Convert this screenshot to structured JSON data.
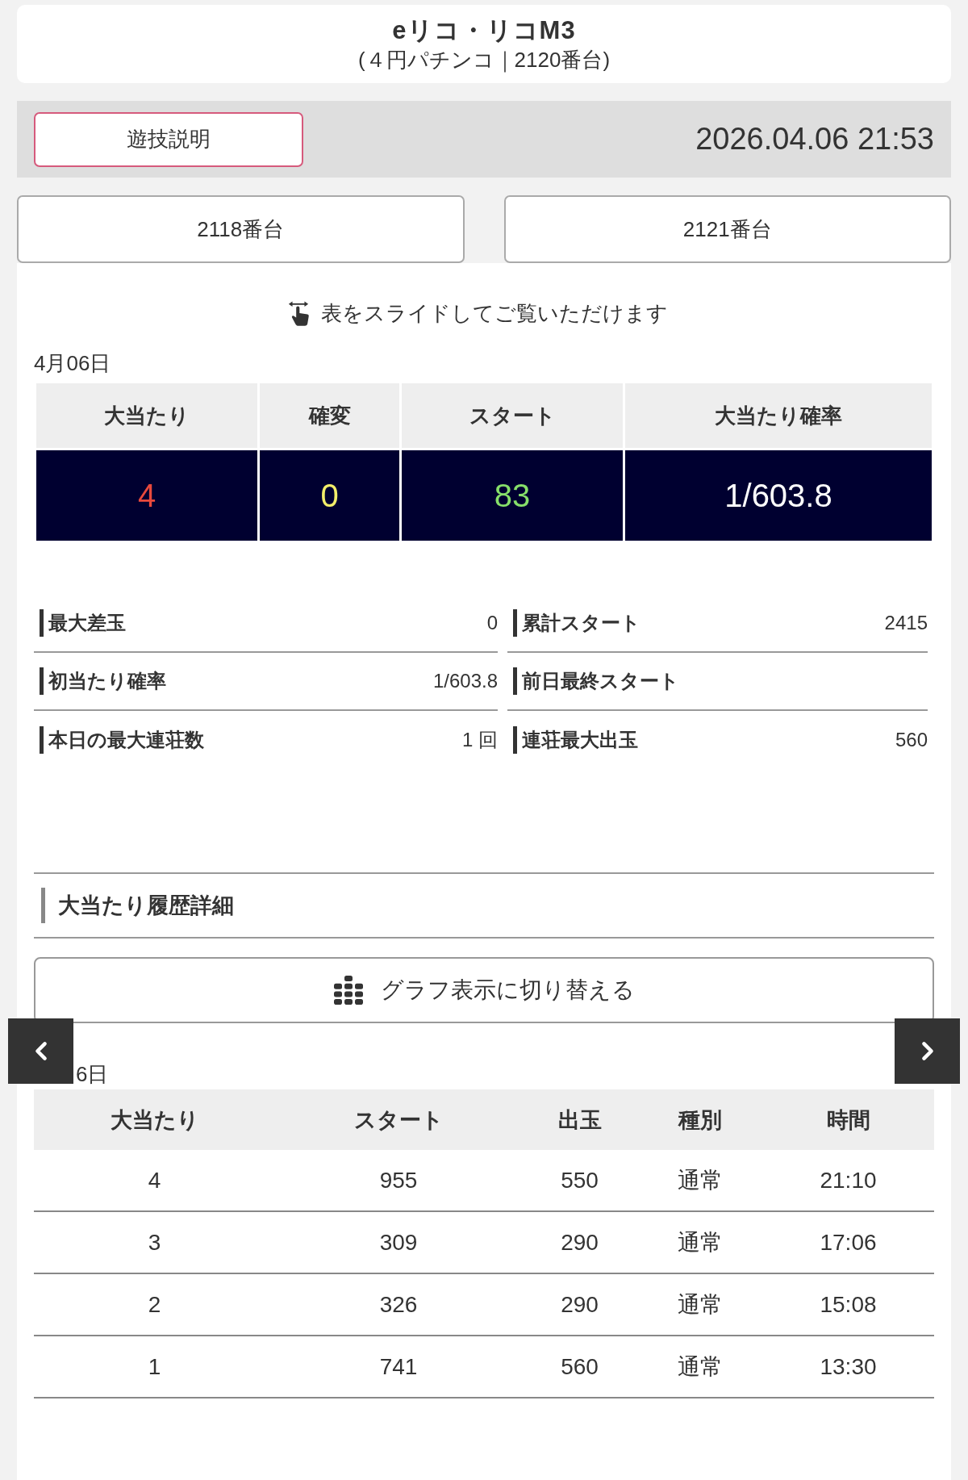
{
  "header": {
    "title": "eリコ・リコM3",
    "subtitle": "(４円パチンコ｜2120番台)"
  },
  "toolbar": {
    "guide_button": "遊技説明",
    "datetime": "2026.04.06 21:53"
  },
  "machine_nav": [
    {
      "label": "2118番台"
    },
    {
      "label": "2121番台"
    }
  ],
  "slide_hint": "表をスライドしてご覧いただけます",
  "summary": {
    "date": "4月06日",
    "columns": [
      "大当たり",
      "確変",
      "スタート",
      "大当たり確率"
    ],
    "values": [
      {
        "text": "4",
        "color": "#e8493d"
      },
      {
        "text": "0",
        "color": "#f3ee6a"
      },
      {
        "text": "83",
        "color": "#86df6a"
      },
      {
        "text": "1/603.8",
        "color": "#ffffff"
      }
    ]
  },
  "stats": [
    {
      "label": "最大差玉",
      "value": "0"
    },
    {
      "label": "累計スタート",
      "value": "2415"
    },
    {
      "label": "初当たり確率",
      "value": "1/603.8"
    },
    {
      "label": "前日最終スタート"
    },
    {
      "label": "本日の最大連荘数",
      "value": "1 回"
    },
    {
      "label": "連荘最大出玉",
      "value": "560"
    }
  ],
  "history": {
    "title": "大当たり履歴詳細",
    "graph_button": "グラフ表示に切り替える",
    "date": "6日",
    "columns": [
      "大当たり",
      "スタート",
      "出玉",
      "種別",
      "時間"
    ],
    "rows": [
      [
        "4",
        "955",
        "550",
        "通常",
        "21:10"
      ],
      [
        "3",
        "309",
        "290",
        "通常",
        "17:06"
      ],
      [
        "2",
        "326",
        "290",
        "通常",
        "15:08"
      ],
      [
        "1",
        "741",
        "560",
        "通常",
        "13:30"
      ]
    ]
  }
}
